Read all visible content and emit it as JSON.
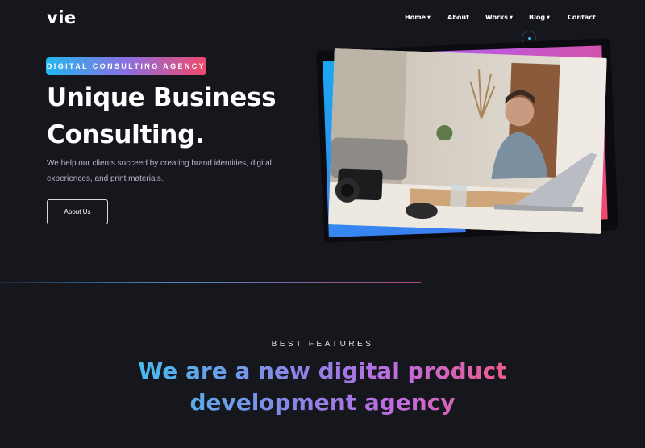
{
  "header": {
    "logo": "vie",
    "nav": [
      {
        "label": "Home",
        "dropdown": true
      },
      {
        "label": "About",
        "dropdown": false
      },
      {
        "label": "Works",
        "dropdown": true
      },
      {
        "label": "Blog",
        "dropdown": true
      },
      {
        "label": "Contact",
        "dropdown": false
      }
    ]
  },
  "hero": {
    "badge": "DIGITAL CONSULTING AGENCY",
    "title_line1": "Unique Business",
    "title_line2": "Consulting.",
    "description": "We help our clients succeed by creating brand identities, digital experiences, and print materials.",
    "button": "About Us"
  },
  "features": {
    "label": "BEST FEATURES",
    "title_line1": "We are a new digital product",
    "title_line2": "development agency"
  },
  "colors": {
    "background": "#16161d",
    "accent_blue": "#22b7ee",
    "accent_purple": "#b45cf0",
    "accent_pink": "#f04a6c"
  },
  "icons": {
    "dropdown": "caret-down-icon",
    "nav_indicator": "dot-indicator-icon"
  }
}
